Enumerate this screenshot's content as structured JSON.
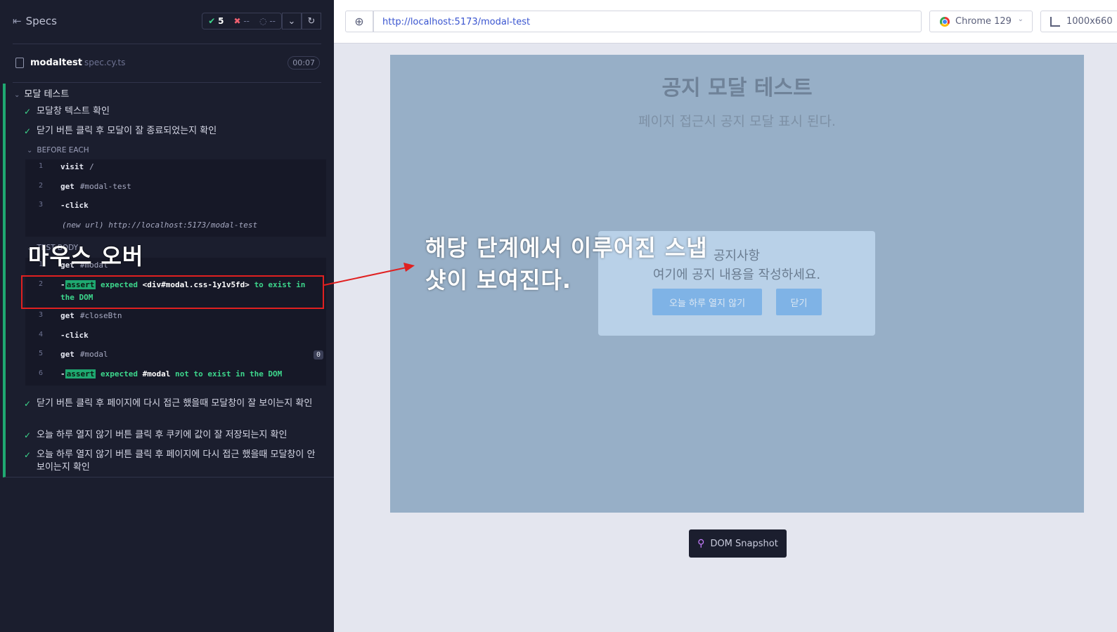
{
  "specs_header": {
    "title": "Specs",
    "passed": "5",
    "failed": "--",
    "pending": "--"
  },
  "spec": {
    "name": "modaltest",
    "ext": "spec.cy.ts",
    "time": "00:07"
  },
  "suite": {
    "title": "모달 테스트"
  },
  "tests": [
    {
      "label": "모달창 텍스트 확인"
    },
    {
      "label": "닫기 버튼 클릭 후 모달이 잘 종료되었는지 확인"
    },
    {
      "label": "닫기 버튼 클릭 후 페이지에 다시 접근 했을때 모달창이 잘 보이는지 확인"
    },
    {
      "label": "오늘 하루 열지 않기 버튼 클릭 후 쿠키에 값이 잘 저장되는지 확인"
    },
    {
      "label": "오늘 하루 열지 않기 버튼 클릭 후 페이지에 다시 접근 했을때 모달창이 안보이는지 확인"
    }
  ],
  "before_each": {
    "label": "BEFORE EACH",
    "commands": [
      {
        "num": "1",
        "name": "visit",
        "arg": "/"
      },
      {
        "num": "2",
        "name": "get",
        "arg": "#modal-test"
      },
      {
        "num": "3",
        "name": "-click",
        "arg": ""
      }
    ],
    "new_url": "(new url)  http://localhost:5173/modal-test"
  },
  "test_body": {
    "label": "TEST BODY",
    "commands": [
      {
        "num": "1",
        "name": "get",
        "arg": "#modal"
      },
      {
        "num": "2",
        "prefix": "-",
        "badge": "assert",
        "text1": "expected",
        "el": "<div#modal.css-1y1v5fd>",
        "text2": "to exist",
        "text3": "in the DOM"
      },
      {
        "num": "3",
        "name": "get",
        "arg": "#closeBtn"
      },
      {
        "num": "4",
        "name": "-click",
        "arg": ""
      },
      {
        "num": "5",
        "name": "get",
        "arg": "#modal",
        "count": "0"
      },
      {
        "num": "6",
        "prefix": "-",
        "badge": "assert",
        "text1": "expected",
        "el": "#modal",
        "text2": "not to exist in the DOM"
      }
    ]
  },
  "annotation_left": "마우스 오버",
  "annotation_right_line1": "해당 단계에서 이루어진 스냅",
  "annotation_right_line2": "샷이 보여진다.",
  "browser": {
    "url": "http://localhost:5173/modal-test",
    "name": "Chrome 129",
    "viewport": "1000x660"
  },
  "app": {
    "title": "공지 모달 테스트",
    "subtitle": "페이지 접근시 공지 모달 표시 된다.",
    "modal": {
      "title": "공지사항",
      "body": "여기에 공지 내용을 작성하세요.",
      "btn_hide_today": "오늘 하루 열지 않기",
      "btn_close": "닫기"
    }
  },
  "snapshot_label": "DOM Snapshot",
  "colors": {
    "pass": "#3dd68c",
    "highlight": "#e02020",
    "app_bg": "#97afc7"
  }
}
